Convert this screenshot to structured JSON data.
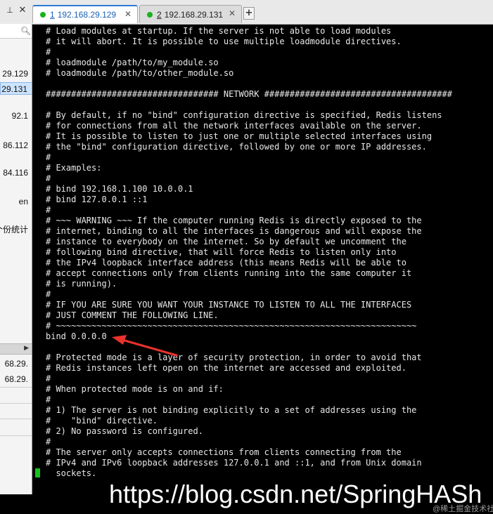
{
  "tabbar": {
    "pin_icon": "pin-icon",
    "close_icon": "close-icon",
    "tabs": [
      {
        "index": "1",
        "label": "192.168.29.129",
        "active": true
      },
      {
        "index": "2",
        "label": "192.168.29.131",
        "active": false
      }
    ],
    "add_label": "+",
    "close_glyph": "✕",
    "accent": "#2b79d6",
    "status_color": "#19b31d"
  },
  "sidebar": {
    "items": [
      {
        "text": "29.129"
      },
      {
        "text": "29.131"
      },
      {
        "text": "92.1"
      },
      {
        "text": "86.112"
      },
      {
        "text": "84.116"
      },
      {
        "text": "en"
      },
      {
        "text": "个份统计"
      },
      {
        "text": "68.29."
      },
      {
        "text": "68.29."
      }
    ]
  },
  "terminal": {
    "lines": [
      "# Load modules at startup. If the server is not able to load modules",
      "# it will abort. It is possible to use multiple loadmodule directives.",
      "#",
      "# loadmodule /path/to/my_module.so",
      "# loadmodule /path/to/other_module.so",
      "",
      "################################## NETWORK #####################################",
      "",
      "# By default, if no \"bind\" configuration directive is specified, Redis listens",
      "# for connections from all the network interfaces available on the server.",
      "# It is possible to listen to just one or multiple selected interfaces using",
      "# the \"bind\" configuration directive, followed by one or more IP addresses.",
      "#",
      "# Examples:",
      "#",
      "# bind 192.168.1.100 10.0.0.1",
      "# bind 127.0.0.1 ::1",
      "#",
      "# ~~~ WARNING ~~~ If the computer running Redis is directly exposed to the",
      "# internet, binding to all the interfaces is dangerous and will expose the",
      "# instance to everybody on the internet. So by default we uncomment the",
      "# following bind directive, that will force Redis to listen only into",
      "# the IPv4 loopback interface address (this means Redis will be able to",
      "# accept connections only from clients running into the same computer it",
      "# is running).",
      "#",
      "# IF YOU ARE SURE YOU WANT YOUR INSTANCE TO LISTEN TO ALL THE INTERFACES",
      "# JUST COMMENT THE FOLLOWING LINE.",
      "# ~~~~~~~~~~~~~~~~~~~~~~~~~~~~~~~~~~~~~~~~~~~~~~~~~~~~~~~~~~~~~~~~~~~~~~~",
      "bind 0.0.0.0",
      "",
      "# Protected mode is a layer of security protection, in order to avoid that",
      "# Redis instances left open on the internet are accessed and exploited.",
      "#",
      "# When protected mode is on and if:",
      "#",
      "# 1) The server is not binding explicitly to a set of addresses using the",
      "#    \"bind\" directive.",
      "# 2) No password is configured.",
      "#",
      "# The server only accepts connections from clients connecting from the",
      "# IPv4 and IPv6 loopback addresses 127.0.0.1 and ::1, and from Unix domain",
      "  sockets."
    ],
    "cursor_color": "#18c11b",
    "arrow_color": "#e8322c"
  },
  "watermark": {
    "text": "https://blog.csdn.net/SpringHASh",
    "corner": "@稀土掘金技术社区"
  }
}
